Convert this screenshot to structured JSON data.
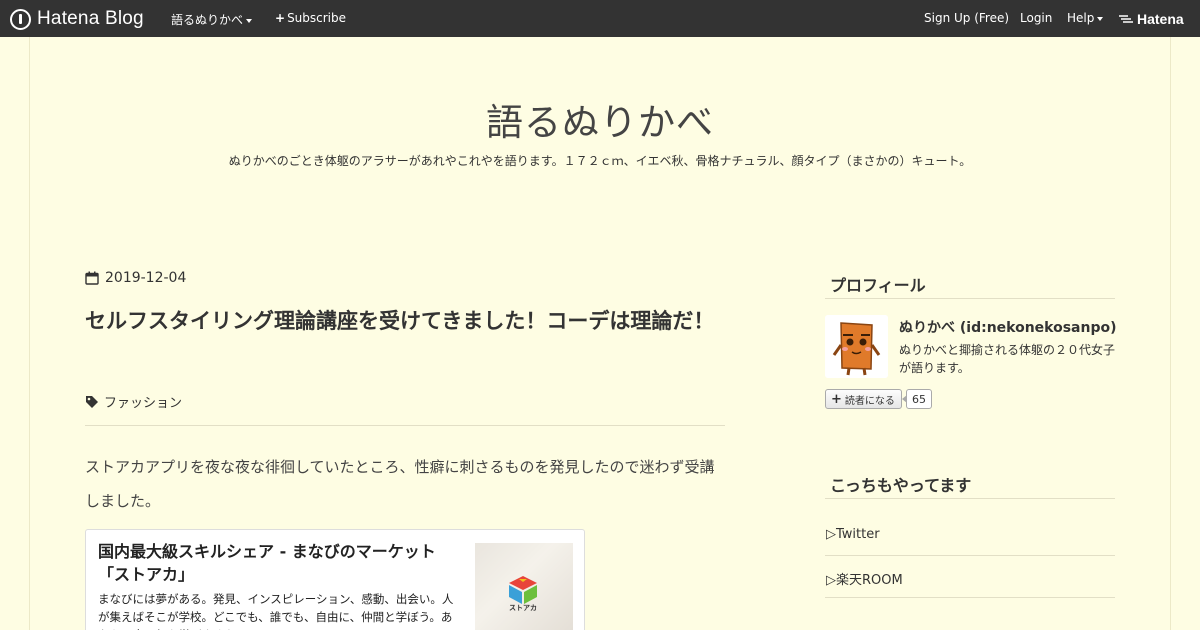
{
  "navbar": {
    "logo_text": "Hatena Blog",
    "blog_menu_label": "語るぬりかべ",
    "subscribe_label": "Subscribe",
    "signup_label": "Sign Up (Free)",
    "login_label": "Login",
    "help_label": "Help",
    "hatena_label": "Hatena"
  },
  "blog": {
    "title": "語るぬりかべ",
    "description": "ぬりかべのごとき体躯のアラサーがあれやこれやを語ります。１７２ｃｍ、イエベ秋、骨格ナチュラル、顔タイプ（まさかの）キュート。"
  },
  "entry": {
    "date": "2019-12-04",
    "title": "セルフスタイリング理論講座を受けてきました！コーデは理論だ！",
    "category": "ファッション",
    "body": "ストアカアプリを夜な夜な徘徊していたところ、性癖に刺さるものを発見したので迷わず受講しました。",
    "embed": {
      "title": "国内最大級スキルシェア - まなびのマーケット「ストアカ」",
      "description": "まなびには夢がある。発見、インスピレーション、感動、出会い。人が集えばそこが学校。どこでも、誰でも、自由に、仲間と学ぼう。あなたは今日何を学びますか？",
      "thumb_logo_text": "ストアカ"
    }
  },
  "sidebar": {
    "profile_heading": "プロフィール",
    "profile_name": "ぬりかべ (id:nekonekosanpo)",
    "profile_desc": "ぬりかべと揶揄される体躯の２０代女子が語ります。",
    "reader_button": "読者になる",
    "reader_count": "65",
    "links_heading": "こっちもやってます",
    "links": [
      "▷Twitter",
      "▷楽天ROOM"
    ]
  },
  "colors": {
    "background": "#fefde3",
    "navbar": "#333333",
    "text": "#333333"
  }
}
